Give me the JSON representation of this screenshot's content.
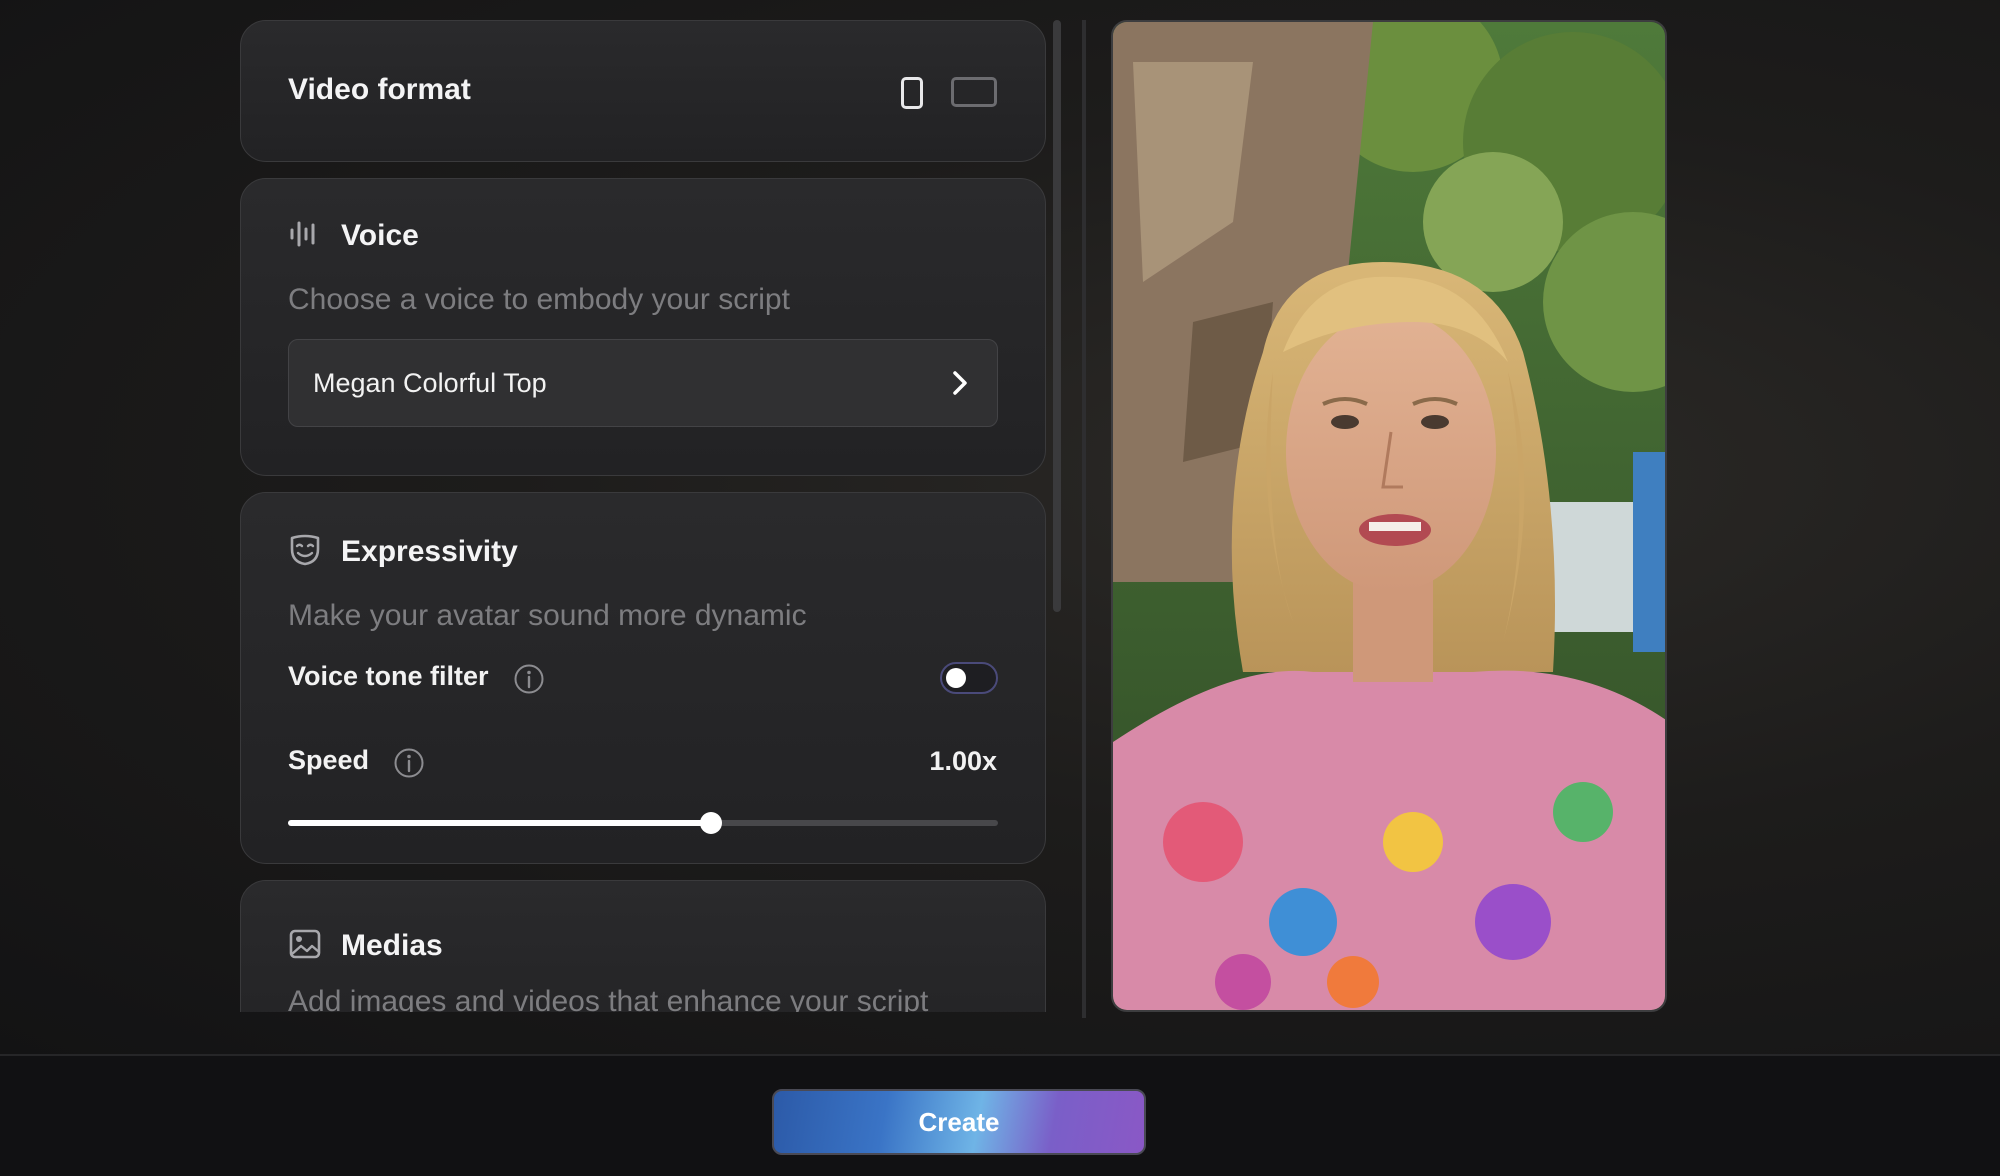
{
  "video_format": {
    "title": "Video format",
    "options": [
      "portrait",
      "landscape"
    ],
    "selected": "portrait"
  },
  "voice": {
    "title": "Voice",
    "subtitle": "Choose a voice to embody your script",
    "selected_voice": "Megan Colorful Top",
    "icon": "waveform-icon"
  },
  "expressivity": {
    "title": "Expressivity",
    "subtitle": "Make your avatar sound more dynamic",
    "icon": "mask-icon",
    "voice_tone_filter": {
      "label": "Voice tone filter",
      "enabled": false
    },
    "speed": {
      "label": "Speed",
      "value_text": "1.00x",
      "fraction": 0.596
    }
  },
  "medias": {
    "title": "Medias",
    "subtitle": "Add images and videos that enhance your script",
    "icon": "image-icon"
  },
  "footer": {
    "create_label": "Create"
  },
  "colors": {
    "background": "#161618",
    "card": "#262628",
    "accent_blue": "#3a74c6",
    "accent_purple": "#8a58c6"
  }
}
